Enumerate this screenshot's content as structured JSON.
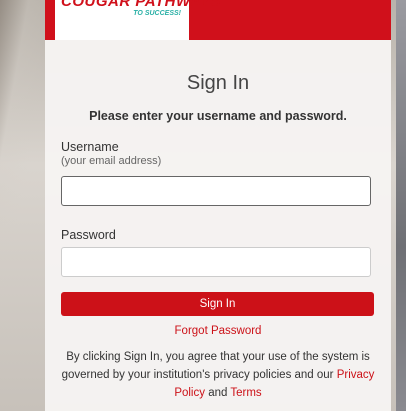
{
  "brand": {
    "logo_text": "COUGAR PATHWAYS",
    "tagline": "TO SUCCESS!"
  },
  "form": {
    "title": "Sign In",
    "subtitle": "Please enter your username and password.",
    "username_label": "Username",
    "username_hint": "(your email address)",
    "username_value": "",
    "password_label": "Password",
    "password_value": "",
    "submit_label": "Sign In",
    "forgot_label": "Forgot Password"
  },
  "legal": {
    "text_before": "By clicking Sign In, you agree that your use of the system is governed by your institution's privacy policies and our ",
    "privacy_link": "Privacy Policy",
    "and": " and ",
    "terms_link": "Terms"
  },
  "colors": {
    "brand_red": "#cc1118",
    "accent_teal": "#2ab0a6"
  }
}
